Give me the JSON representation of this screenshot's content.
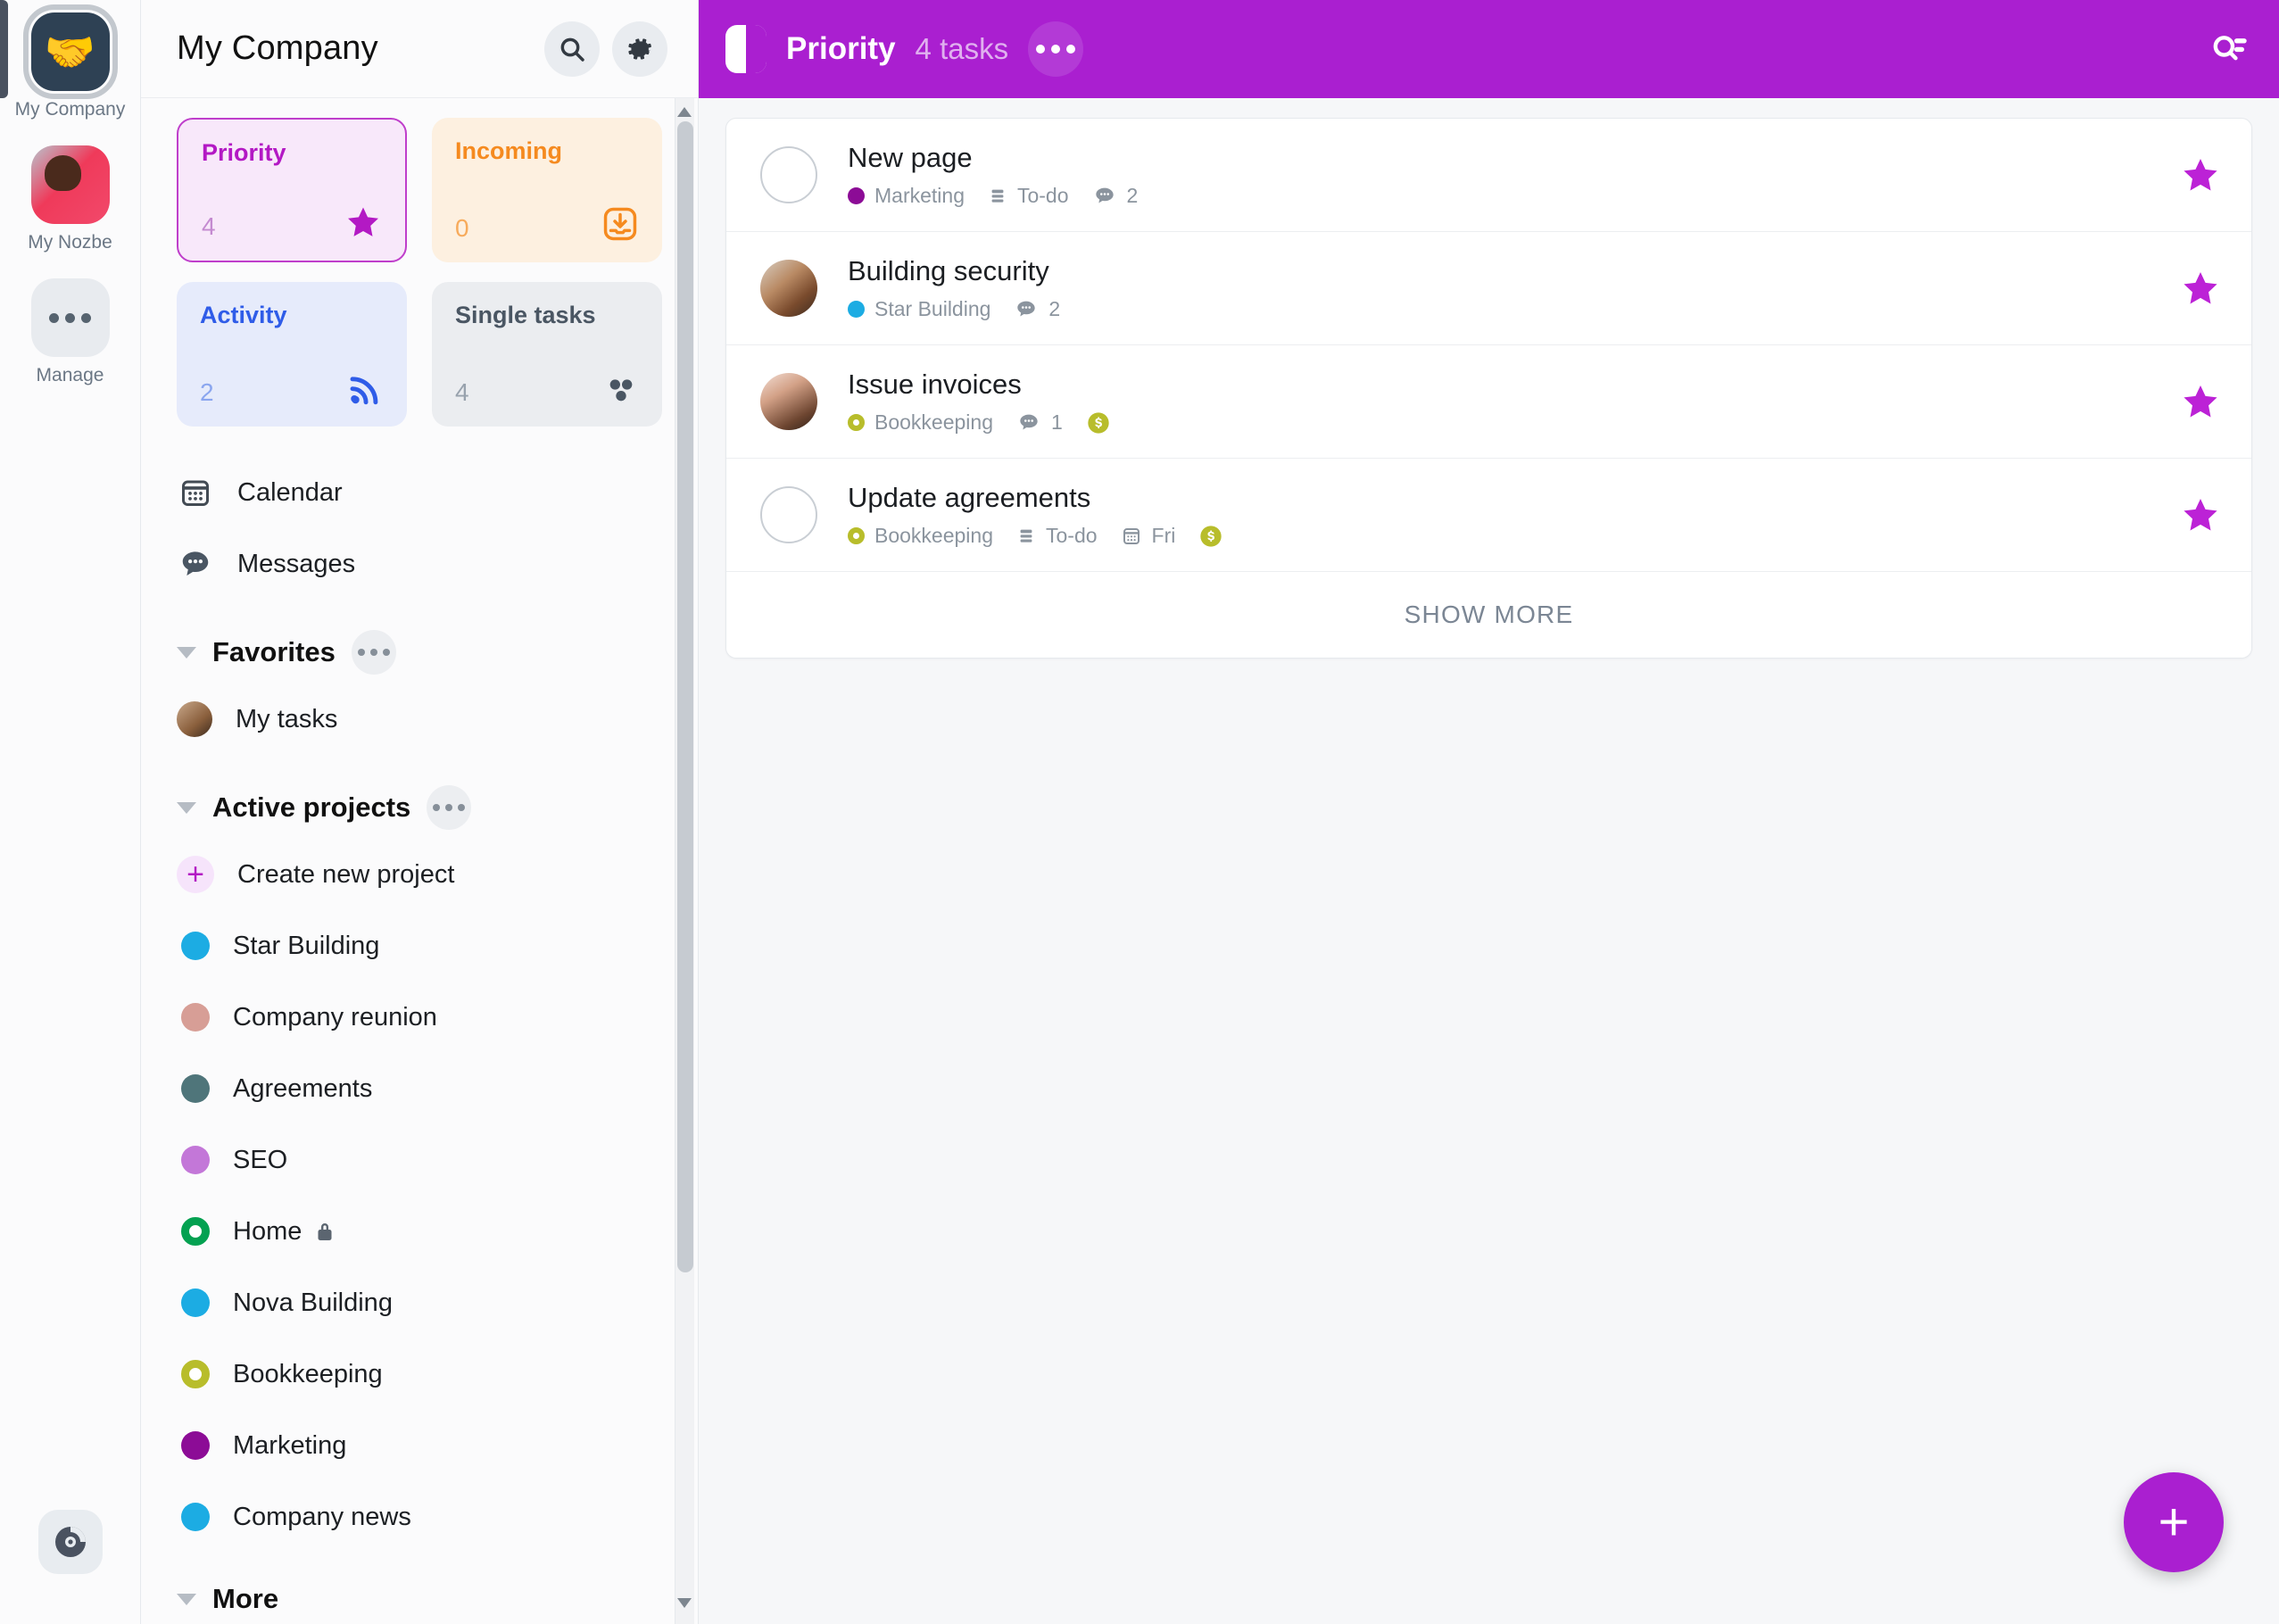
{
  "rail": {
    "workspaces": [
      {
        "label": "My Company",
        "icon": "handshake-avatar",
        "selected": true
      },
      {
        "label": "My Nozbe",
        "icon": "person-avatar",
        "selected": false
      },
      {
        "label": "Manage",
        "icon": "ellipsis-icon",
        "selected": false
      }
    ],
    "bottom_button": "nozbe-logo-icon"
  },
  "sidebar": {
    "title": "My Company",
    "search_icon": "search-icon",
    "settings_icon": "gear-icon",
    "cards": [
      {
        "title": "Priority",
        "count": "4",
        "icon": "star-icon",
        "accent": "#b319c4"
      },
      {
        "title": "Incoming",
        "count": "0",
        "icon": "inbox-download-icon",
        "accent": "#f58a1f"
      },
      {
        "title": "Activity",
        "count": "2",
        "icon": "rss-activity-icon",
        "accent": "#2f5ce8"
      },
      {
        "title": "Single tasks",
        "count": "4",
        "icon": "three-dots-cluster-icon",
        "accent": "#4a5663"
      }
    ],
    "nav": [
      {
        "label": "Calendar",
        "icon": "calendar-icon"
      },
      {
        "label": "Messages",
        "icon": "message-bubble-icon"
      }
    ],
    "favorites": {
      "title": "Favorites",
      "more_icon": "ellipsis-icon",
      "items": [
        {
          "label": "My tasks",
          "icon": "user-avatar"
        }
      ]
    },
    "active_projects": {
      "title": "Active projects",
      "more_icon": "ellipsis-icon",
      "create_label": "Create new project",
      "create_icon": "plus-icon",
      "items": [
        {
          "label": "Star Building",
          "color": "#1cace3",
          "style": "solid",
          "locked": false
        },
        {
          "label": "Company reunion",
          "color": "#d79e96",
          "style": "solid",
          "locked": false
        },
        {
          "label": "Agreements",
          "color": "#4f757a",
          "style": "solid",
          "locked": false
        },
        {
          "label": "SEO",
          "color": "#c377d8",
          "style": "solid",
          "locked": false
        },
        {
          "label": "Home",
          "color": "#04a151",
          "style": "ring",
          "locked": true
        },
        {
          "label": "Nova Building",
          "color": "#1cace3",
          "style": "solid",
          "locked": false
        },
        {
          "label": "Bookkeeping",
          "color": "#b8bd2b",
          "style": "ring",
          "locked": false
        },
        {
          "label": "Marketing",
          "color": "#8c0c96",
          "style": "solid",
          "locked": false
        },
        {
          "label": "Company news",
          "color": "#1cace3",
          "style": "solid",
          "locked": false
        }
      ]
    },
    "more_section": {
      "title": "More"
    }
  },
  "topbar": {
    "panel_toggle_icon": "panel-toggle-icon",
    "title": "Priority",
    "count": "4 tasks",
    "more_icon": "ellipsis-icon",
    "search_icon": "search-filter-icon",
    "background": "#aa1fd0"
  },
  "tasks": {
    "rows": [
      {
        "title": "New page",
        "lead": "checkbox",
        "starred": true,
        "meta": [
          {
            "type": "project",
            "label": "Marketing",
            "color": "#8c0c96",
            "style": "solid"
          },
          {
            "type": "list",
            "label": "To-do",
            "icon": "list-icon"
          },
          {
            "type": "comments",
            "label": "2",
            "icon": "comment-icon"
          }
        ]
      },
      {
        "title": "Building security",
        "lead": "avatar-1",
        "starred": true,
        "meta": [
          {
            "type": "project",
            "label": "Star Building",
            "color": "#1cace3",
            "style": "solid"
          },
          {
            "type": "comments",
            "label": "2",
            "icon": "comment-icon"
          }
        ]
      },
      {
        "title": "Issue invoices",
        "lead": "avatar-2",
        "starred": true,
        "meta": [
          {
            "type": "project",
            "label": "Bookkeeping",
            "color": "#b8bd2b",
            "style": "ring"
          },
          {
            "type": "comments",
            "label": "1",
            "icon": "comment-icon"
          },
          {
            "type": "badge",
            "label": "",
            "icon": "dollar-icon",
            "color": "#b8bd2b"
          }
        ]
      },
      {
        "title": "Update agreements",
        "lead": "checkbox",
        "starred": true,
        "meta": [
          {
            "type": "project",
            "label": "Bookkeeping",
            "color": "#b8bd2b",
            "style": "ring"
          },
          {
            "type": "list",
            "label": "To-do",
            "icon": "list-icon"
          },
          {
            "type": "date",
            "label": "Fri",
            "icon": "calendar-icon"
          },
          {
            "type": "badge",
            "label": "",
            "icon": "dollar-icon",
            "color": "#b8bd2b"
          }
        ]
      }
    ],
    "show_more_label": "SHOW MORE",
    "add_button_icon": "plus-icon"
  }
}
